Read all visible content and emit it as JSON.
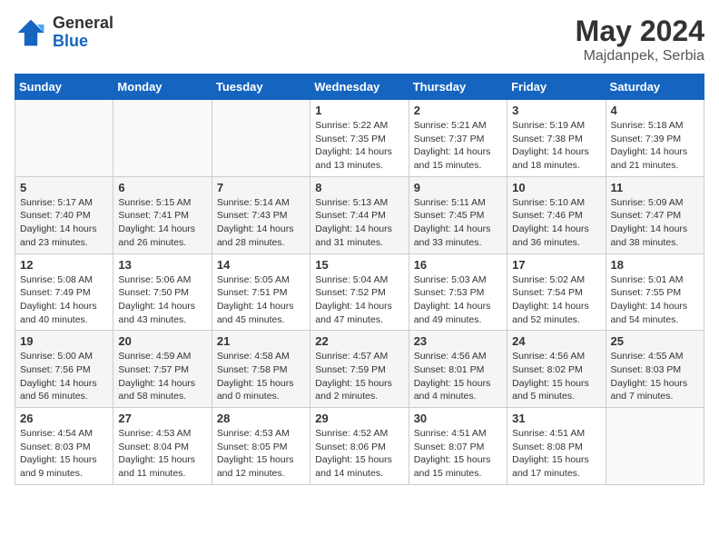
{
  "header": {
    "logo_general": "General",
    "logo_blue": "Blue",
    "title": "May 2024",
    "subtitle": "Majdanpek, Serbia"
  },
  "weekdays": [
    "Sunday",
    "Monday",
    "Tuesday",
    "Wednesday",
    "Thursday",
    "Friday",
    "Saturday"
  ],
  "weeks": [
    {
      "shaded": false,
      "days": [
        {
          "num": "",
          "info": ""
        },
        {
          "num": "",
          "info": ""
        },
        {
          "num": "",
          "info": ""
        },
        {
          "num": "1",
          "info": "Sunrise: 5:22 AM\nSunset: 7:35 PM\nDaylight: 14 hours\nand 13 minutes."
        },
        {
          "num": "2",
          "info": "Sunrise: 5:21 AM\nSunset: 7:37 PM\nDaylight: 14 hours\nand 15 minutes."
        },
        {
          "num": "3",
          "info": "Sunrise: 5:19 AM\nSunset: 7:38 PM\nDaylight: 14 hours\nand 18 minutes."
        },
        {
          "num": "4",
          "info": "Sunrise: 5:18 AM\nSunset: 7:39 PM\nDaylight: 14 hours\nand 21 minutes."
        }
      ]
    },
    {
      "shaded": true,
      "days": [
        {
          "num": "5",
          "info": "Sunrise: 5:17 AM\nSunset: 7:40 PM\nDaylight: 14 hours\nand 23 minutes."
        },
        {
          "num": "6",
          "info": "Sunrise: 5:15 AM\nSunset: 7:41 PM\nDaylight: 14 hours\nand 26 minutes."
        },
        {
          "num": "7",
          "info": "Sunrise: 5:14 AM\nSunset: 7:43 PM\nDaylight: 14 hours\nand 28 minutes."
        },
        {
          "num": "8",
          "info": "Sunrise: 5:13 AM\nSunset: 7:44 PM\nDaylight: 14 hours\nand 31 minutes."
        },
        {
          "num": "9",
          "info": "Sunrise: 5:11 AM\nSunset: 7:45 PM\nDaylight: 14 hours\nand 33 minutes."
        },
        {
          "num": "10",
          "info": "Sunrise: 5:10 AM\nSunset: 7:46 PM\nDaylight: 14 hours\nand 36 minutes."
        },
        {
          "num": "11",
          "info": "Sunrise: 5:09 AM\nSunset: 7:47 PM\nDaylight: 14 hours\nand 38 minutes."
        }
      ]
    },
    {
      "shaded": false,
      "days": [
        {
          "num": "12",
          "info": "Sunrise: 5:08 AM\nSunset: 7:49 PM\nDaylight: 14 hours\nand 40 minutes."
        },
        {
          "num": "13",
          "info": "Sunrise: 5:06 AM\nSunset: 7:50 PM\nDaylight: 14 hours\nand 43 minutes."
        },
        {
          "num": "14",
          "info": "Sunrise: 5:05 AM\nSunset: 7:51 PM\nDaylight: 14 hours\nand 45 minutes."
        },
        {
          "num": "15",
          "info": "Sunrise: 5:04 AM\nSunset: 7:52 PM\nDaylight: 14 hours\nand 47 minutes."
        },
        {
          "num": "16",
          "info": "Sunrise: 5:03 AM\nSunset: 7:53 PM\nDaylight: 14 hours\nand 49 minutes."
        },
        {
          "num": "17",
          "info": "Sunrise: 5:02 AM\nSunset: 7:54 PM\nDaylight: 14 hours\nand 52 minutes."
        },
        {
          "num": "18",
          "info": "Sunrise: 5:01 AM\nSunset: 7:55 PM\nDaylight: 14 hours\nand 54 minutes."
        }
      ]
    },
    {
      "shaded": true,
      "days": [
        {
          "num": "19",
          "info": "Sunrise: 5:00 AM\nSunset: 7:56 PM\nDaylight: 14 hours\nand 56 minutes."
        },
        {
          "num": "20",
          "info": "Sunrise: 4:59 AM\nSunset: 7:57 PM\nDaylight: 14 hours\nand 58 minutes."
        },
        {
          "num": "21",
          "info": "Sunrise: 4:58 AM\nSunset: 7:58 PM\nDaylight: 15 hours\nand 0 minutes."
        },
        {
          "num": "22",
          "info": "Sunrise: 4:57 AM\nSunset: 7:59 PM\nDaylight: 15 hours\nand 2 minutes."
        },
        {
          "num": "23",
          "info": "Sunrise: 4:56 AM\nSunset: 8:01 PM\nDaylight: 15 hours\nand 4 minutes."
        },
        {
          "num": "24",
          "info": "Sunrise: 4:56 AM\nSunset: 8:02 PM\nDaylight: 15 hours\nand 5 minutes."
        },
        {
          "num": "25",
          "info": "Sunrise: 4:55 AM\nSunset: 8:03 PM\nDaylight: 15 hours\nand 7 minutes."
        }
      ]
    },
    {
      "shaded": false,
      "days": [
        {
          "num": "26",
          "info": "Sunrise: 4:54 AM\nSunset: 8:03 PM\nDaylight: 15 hours\nand 9 minutes."
        },
        {
          "num": "27",
          "info": "Sunrise: 4:53 AM\nSunset: 8:04 PM\nDaylight: 15 hours\nand 11 minutes."
        },
        {
          "num": "28",
          "info": "Sunrise: 4:53 AM\nSunset: 8:05 PM\nDaylight: 15 hours\nand 12 minutes."
        },
        {
          "num": "29",
          "info": "Sunrise: 4:52 AM\nSunset: 8:06 PM\nDaylight: 15 hours\nand 14 minutes."
        },
        {
          "num": "30",
          "info": "Sunrise: 4:51 AM\nSunset: 8:07 PM\nDaylight: 15 hours\nand 15 minutes."
        },
        {
          "num": "31",
          "info": "Sunrise: 4:51 AM\nSunset: 8:08 PM\nDaylight: 15 hours\nand 17 minutes."
        },
        {
          "num": "",
          "info": ""
        }
      ]
    }
  ]
}
